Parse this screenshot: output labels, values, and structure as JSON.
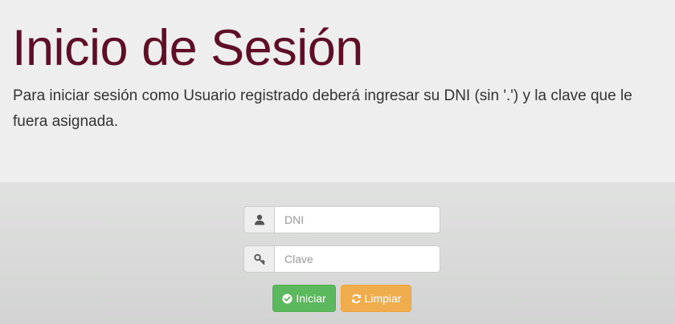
{
  "header": {
    "title": "Inicio de Sesión",
    "lead": "Para iniciar sesión como Usuario registrado deberá ingresar su DNI (sin '.') y la clave que le fuera asignada."
  },
  "form": {
    "dni": {
      "icon": "user-icon",
      "placeholder": "DNI",
      "value": ""
    },
    "clave": {
      "icon": "key-icon",
      "placeholder": "Clave",
      "value": ""
    },
    "submit": {
      "icon": "check-circle-icon",
      "label": "Iniciar"
    },
    "reset": {
      "icon": "refresh-icon",
      "label": "Limpiar"
    }
  },
  "colors": {
    "title": "#5e0f27",
    "success": "#5cb85c",
    "warning": "#f0ad4e"
  }
}
